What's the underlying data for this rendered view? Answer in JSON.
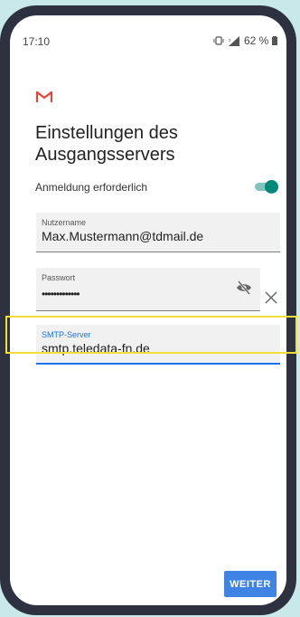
{
  "status_bar": {
    "time": "17:10",
    "battery": "62 %",
    "icons": [
      "vibrate-icon",
      "signal-icon",
      "battery-icon"
    ]
  },
  "app": {
    "logo": "gmail-logo"
  },
  "page": {
    "title_line1": "Einstellungen des",
    "title_line2": "Ausgangsservers"
  },
  "login_required": {
    "label": "Anmeldung erforderlich",
    "enabled": true
  },
  "username": {
    "label": "Nutzername",
    "value": "Max.Mustermann@tdmail.de"
  },
  "password": {
    "label": "Passwort",
    "value": "•••••••••••••"
  },
  "smtp_server": {
    "label": "SMTP-Server",
    "value": "smtp.teledata-fn.de"
  },
  "actions": {
    "next_label": "WEITER"
  },
  "colors": {
    "background": "#c9e8ea",
    "phone_frame": "#2e3240",
    "accent_blue": "#1a73e8",
    "toggle_teal": "#00897b",
    "highlight_yellow": "#f2df39",
    "button_blue": "#3f84e5"
  }
}
